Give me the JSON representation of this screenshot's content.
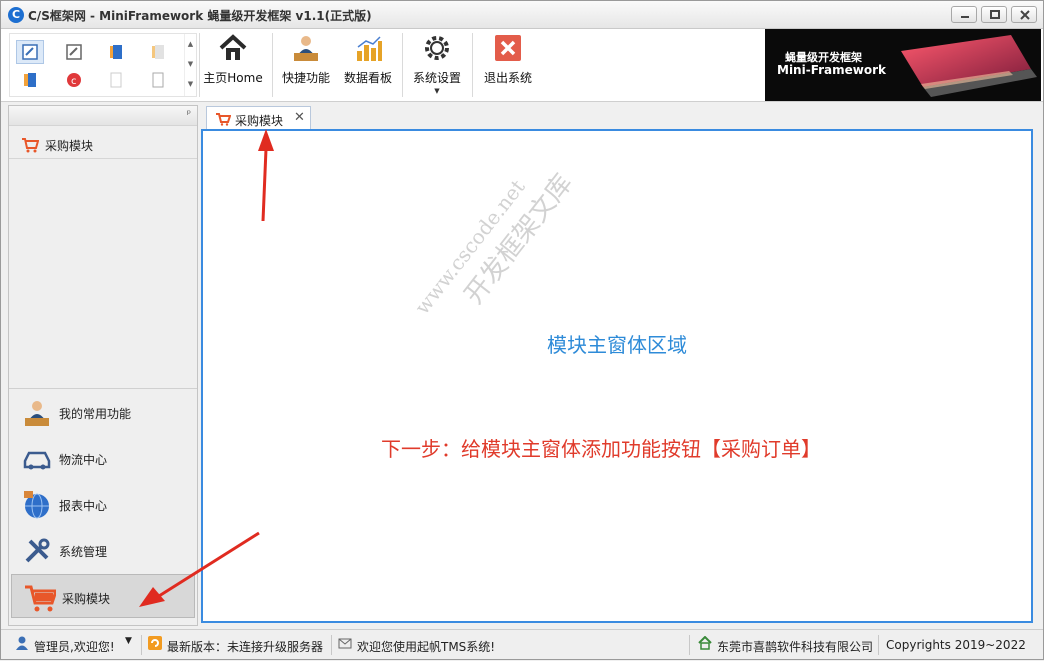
{
  "window": {
    "title": "C/S框架网 - MiniFramework 蝇量级开发框架 v1.1(正式版)"
  },
  "ribbon": {
    "buttons": [
      {
        "label": "主页Home",
        "icon": "home-icon"
      },
      {
        "label": "快捷功能",
        "icon": "user-desk-icon"
      },
      {
        "label": "数据看板",
        "icon": "bar-chart-icon"
      },
      {
        "label": "系统设置",
        "icon": "gear-icon"
      },
      {
        "label": "退出系统",
        "icon": "exit-icon"
      }
    ],
    "banner": {
      "line1": "蝇量级开发框架",
      "line2": "Mini-Framework"
    }
  },
  "nav": {
    "current_item": "采购模块",
    "groups": [
      {
        "label": "我的常用功能",
        "icon": "user-desk-icon"
      },
      {
        "label": "物流中心",
        "icon": "car-icon"
      },
      {
        "label": "报表中心",
        "icon": "globe-icon"
      },
      {
        "label": "系统管理",
        "icon": "tools-icon"
      },
      {
        "label": "采购模块",
        "icon": "cart-icon",
        "active": true
      }
    ]
  },
  "tabs": [
    {
      "label": "采购模块",
      "icon": "cart-icon",
      "closable": true
    }
  ],
  "content": {
    "watermark_line1": "www.cscode.net",
    "watermark_line2": "开发框架文库",
    "module_area_text": "模块主窗体区域",
    "next_step_text": "下一步：给模块主窗体添加功能按钮【采购订单】"
  },
  "status": {
    "user": "管理员,欢迎您!",
    "version": "最新版本：未连接升级服务器",
    "welcome": "欢迎您使用起帆TMS系统!",
    "company": "东莞市喜鹊软件科技有限公司",
    "copyright": "Copyrights 2019~2022"
  },
  "colors": {
    "accent_blue": "#3a8be0",
    "annotation_red": "#e03b2b",
    "cart_orange": "#e8572a"
  }
}
